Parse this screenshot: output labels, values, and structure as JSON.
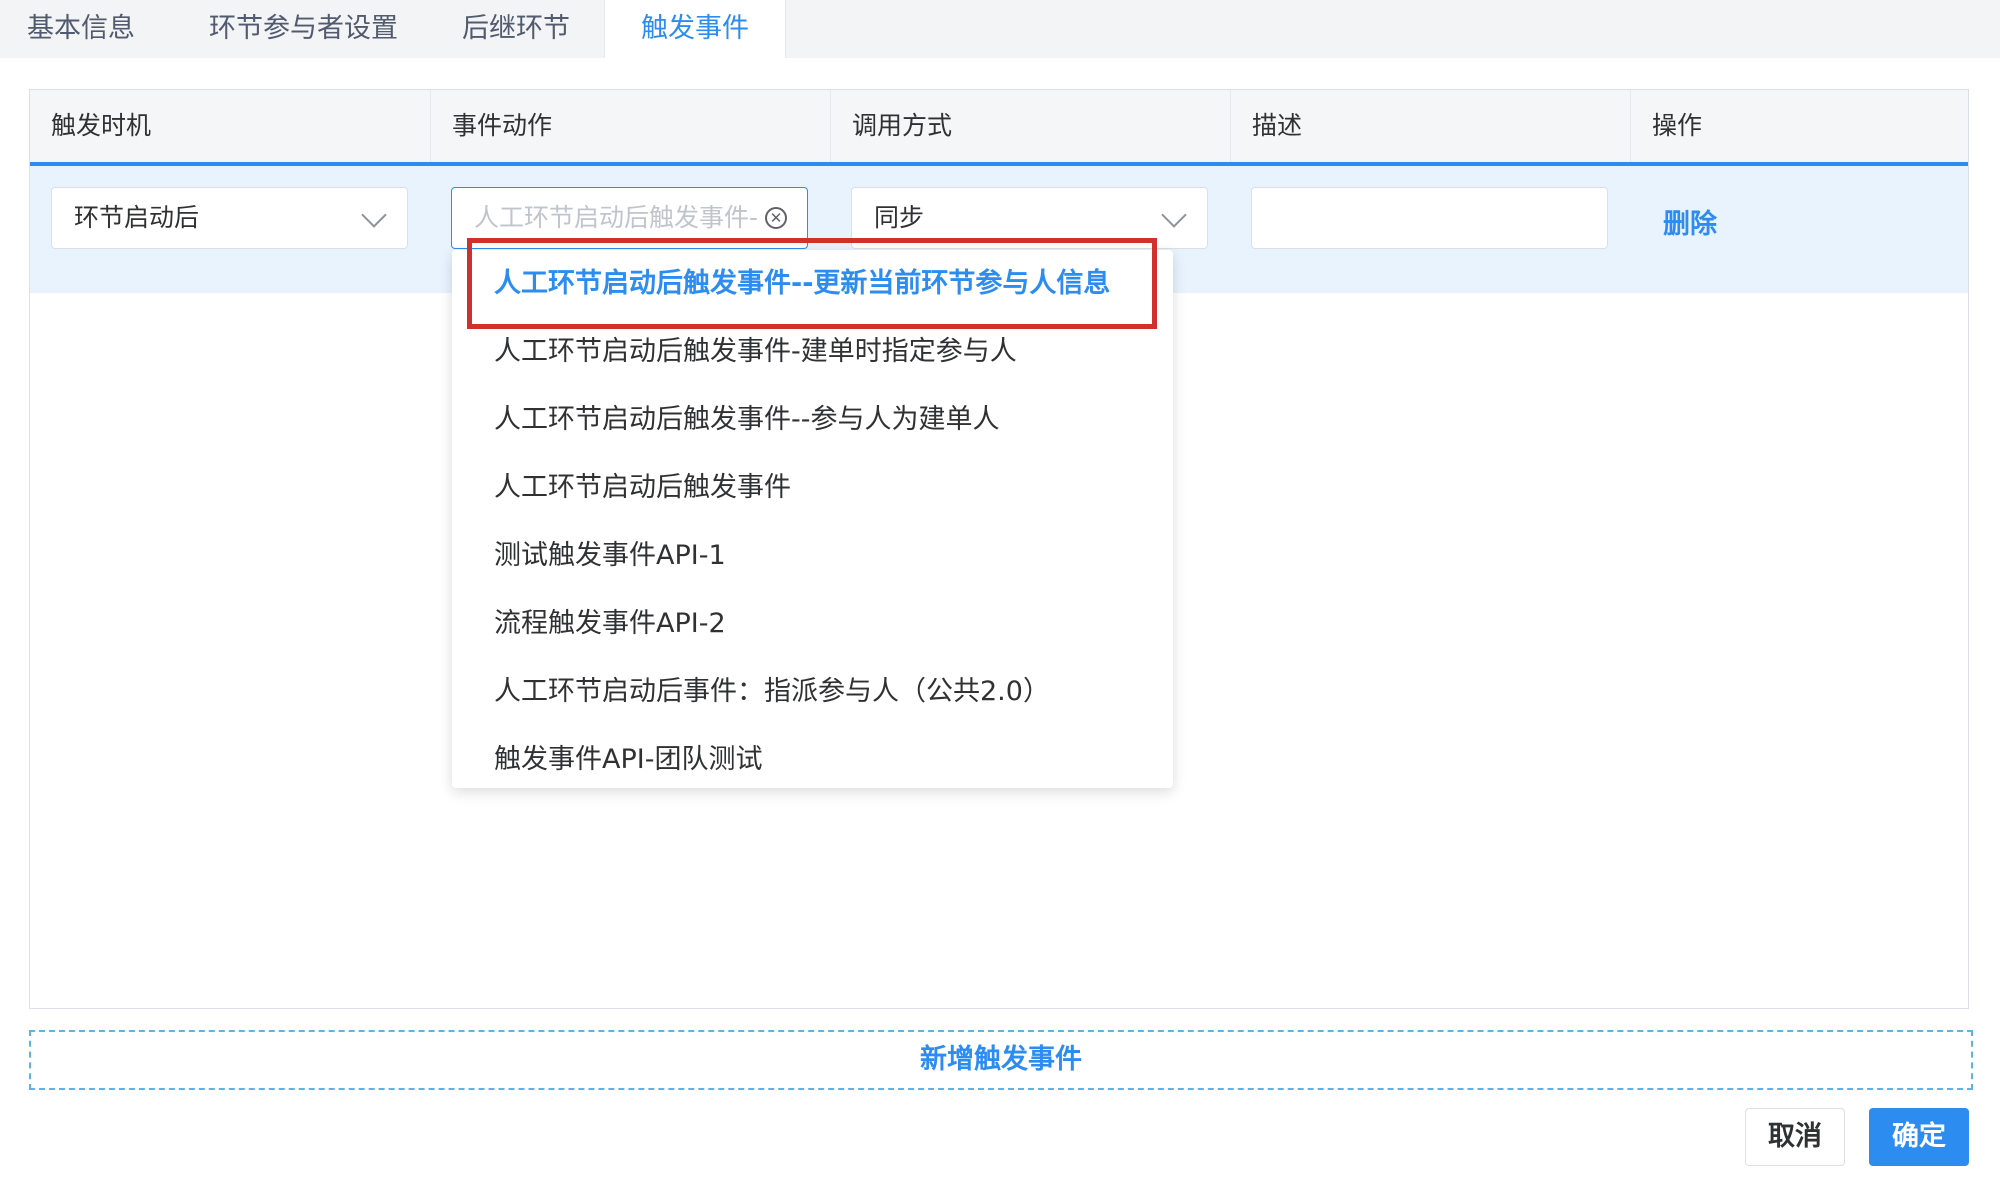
{
  "tabs": [
    {
      "label": "基本信息"
    },
    {
      "label": "环节参与者设置"
    },
    {
      "label": "后继环节"
    },
    {
      "label": "触发事件"
    }
  ],
  "table": {
    "columns": [
      "触发时机",
      "事件动作",
      "调用方式",
      "描述",
      "操作"
    ],
    "row": {
      "trigger_timing": "环节启动后",
      "event_action_placeholder": "人工环节启动后触发事件--更新当前环节参与人信息",
      "call_mode": "同步",
      "description": "",
      "delete_label": "删除"
    }
  },
  "dropdown": {
    "selected_index": 0,
    "options": [
      "人工环节启动后触发事件--更新当前环节参与人信息",
      "人工环节启动后触发事件-建单时指定参与人",
      "人工环节启动后触发事件--参与人为建单人",
      "人工环节启动后触发事件",
      "测试触发事件API-1",
      "流程触发事件API-2",
      "人工环节启动后事件：指派参与人（公共2.0）",
      "触发事件API-团队测试"
    ]
  },
  "add_event_label": "新增触发事件",
  "buttons": {
    "cancel": "取消",
    "confirm": "确定"
  },
  "colors": {
    "accent": "#2d8cf0",
    "highlight_border": "#d0312d",
    "row_bg": "#e8f3fe"
  }
}
